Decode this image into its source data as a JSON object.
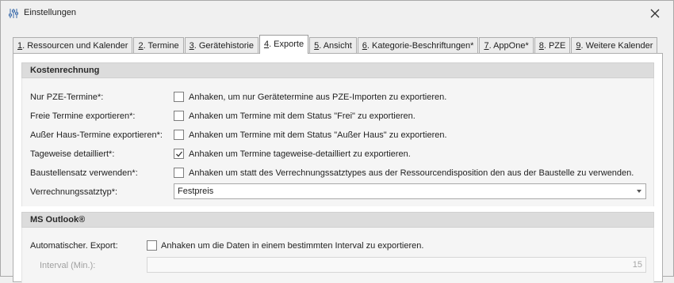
{
  "window": {
    "title": "Einstellungen",
    "icon": "sliders-icon",
    "close_icon": "close-icon"
  },
  "tabs": [
    {
      "key": "1",
      "label": ". Ressourcen und Kalender",
      "active": false
    },
    {
      "key": "2",
      "label": ". Termine",
      "active": false
    },
    {
      "key": "3",
      "label": ". Gerätehistorie",
      "active": false
    },
    {
      "key": "4",
      "label": ". Exporte",
      "active": true
    },
    {
      "key": "5",
      "label": ". Ansicht",
      "active": false
    },
    {
      "key": "6",
      "label": ". Kategorie-Beschriftungen*",
      "active": false
    },
    {
      "key": "7",
      "label": ". AppOne*",
      "active": false
    },
    {
      "key": "8",
      "label": ". PZE",
      "active": false
    },
    {
      "key": "9",
      "label": ". Weitere Kalender",
      "active": false
    }
  ],
  "kostenrechnung": {
    "header": "Kostenrechnung",
    "rows": [
      {
        "label": "Nur PZE-Termine*:",
        "checked": false,
        "text": "Anhaken, um nur Gerätetermine aus PZE-Importen zu exportieren."
      },
      {
        "label": "Freie Termine exportieren*:",
        "checked": false,
        "text": "Anhaken um Termine mit dem Status \"Frei\" zu exportieren."
      },
      {
        "label": "Außer Haus-Termine exportieren*:",
        "checked": false,
        "text": "Anhaken um Termine mit dem Status \"Außer Haus\" zu exportieren."
      },
      {
        "label": "Tageweise detailliert*:",
        "checked": true,
        "text": "Anhaken um Termine tageweise-detailliert zu exportieren."
      },
      {
        "label": "Baustellensatz verwenden*:",
        "checked": false,
        "text": "Anhaken um statt des Verrechnungssatztypes aus der Ressourcendisposition den aus der Baustelle zu verwenden."
      }
    ],
    "verrechnung": {
      "label": "Verrechnungssatztyp*:",
      "value": "Festpreis"
    }
  },
  "outlook": {
    "header": "MS Outlook®",
    "auto_export": {
      "label": "Automatischer. Export:",
      "checked": false,
      "text": "Anhaken um die Daten in einem bestimmten Interval zu exportieren."
    },
    "interval": {
      "label": "Interval (Min.):",
      "value": "15"
    }
  }
}
